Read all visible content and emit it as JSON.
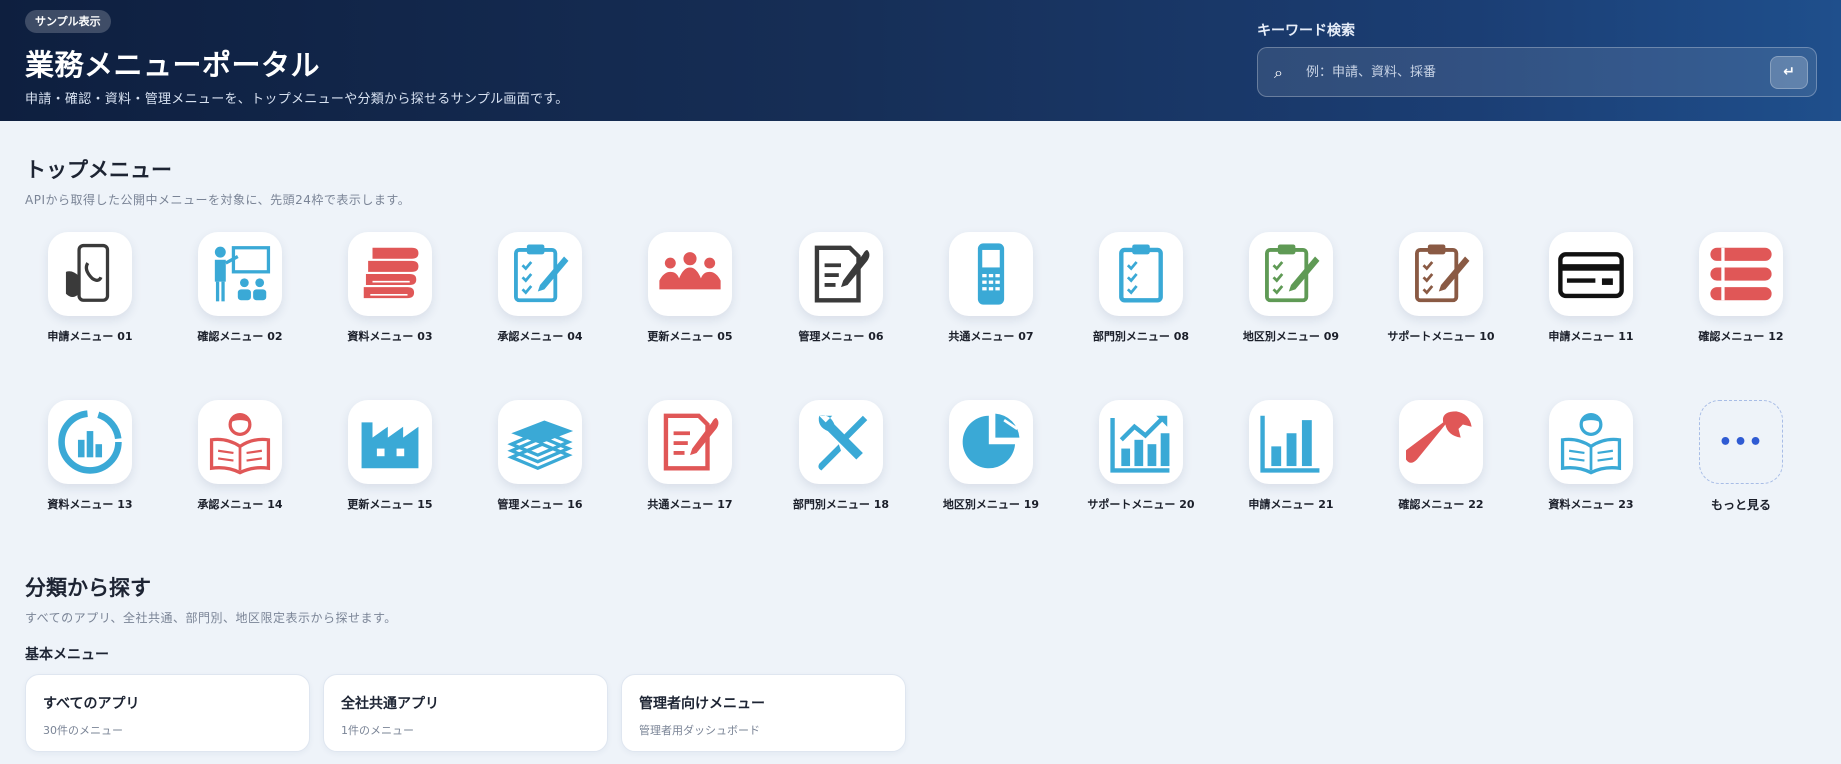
{
  "header": {
    "badge": "サンプル表示",
    "title": "業務メニューポータル",
    "subtitle": "申請・確認・資料・管理メニューを、トップメニューや分類から探せるサンプル画面です。",
    "search_label": "キーワード検索",
    "search_placeholder": "例：申請、資料、採番",
    "search_icon": "search-icon",
    "enter_icon": "enter-icon"
  },
  "top_menu": {
    "title": "トップメニュー",
    "description": "APIから取得した公開中メニューを対象に、先頭24枠で表示します。",
    "apps": [
      {
        "label": "申請メニュー 01",
        "icon": "phone-hand-icon",
        "color": "#3a3a3a"
      },
      {
        "label": "確認メニュー 02",
        "icon": "presentation-icon",
        "color": "#3aa9d6"
      },
      {
        "label": "資料メニュー 03",
        "icon": "books-icon",
        "color": "#e05757"
      },
      {
        "label": "承認メニュー 04",
        "icon": "clipboard-pen-icon",
        "color": "#3aa9d6"
      },
      {
        "label": "更新メニュー 05",
        "icon": "audience-icon",
        "color": "#e05757"
      },
      {
        "label": "管理メニュー 06",
        "icon": "document-pen-icon",
        "color": "#3a3a3a"
      },
      {
        "label": "共通メニュー 07",
        "icon": "mobile-phone-icon",
        "color": "#3aa9d6"
      },
      {
        "label": "部門別メニュー 08",
        "icon": "checklist-icon",
        "color": "#3aa9d6"
      },
      {
        "label": "地区別メニュー 09",
        "icon": "clipboard-pen-icon",
        "color": "#5f9a55"
      },
      {
        "label": "サポートメニュー 10",
        "icon": "clipboard-pen-icon",
        "color": "#8a5a44"
      },
      {
        "label": "申請メニュー 11",
        "icon": "id-card-icon",
        "color": "#111111"
      },
      {
        "label": "確認メニュー 12",
        "icon": "list-icon",
        "color": "#e05757"
      },
      {
        "label": "資料メニュー 13",
        "icon": "dashboard-chart-icon",
        "color": "#3aa9d6"
      },
      {
        "label": "承認メニュー 14",
        "icon": "reader-icon",
        "color": "#e05757"
      },
      {
        "label": "更新メニュー 15",
        "icon": "factory-icon",
        "color": "#3aa9d6"
      },
      {
        "label": "管理メニュー 16",
        "icon": "money-stack-icon",
        "color": "#3aa9d6"
      },
      {
        "label": "共通メニュー 17",
        "icon": "document-pen-icon",
        "color": "#e05757"
      },
      {
        "label": "部門別メニュー 18",
        "icon": "tools-icon",
        "color": "#3aa9d6"
      },
      {
        "label": "地区別メニュー 19",
        "icon": "pie-chart-icon",
        "color": "#3aa9d6"
      },
      {
        "label": "サポートメニュー 20",
        "icon": "growth-chart-icon",
        "color": "#3aa9d6"
      },
      {
        "label": "申請メニュー 21",
        "icon": "bar-chart-icon",
        "color": "#3aa9d6"
      },
      {
        "label": "確認メニュー 22",
        "icon": "wrench-icon",
        "color": "#e05757"
      },
      {
        "label": "資料メニュー 23",
        "icon": "reader-icon",
        "color": "#3aa9d6"
      }
    ],
    "more": {
      "label": "もっと見る",
      "dots": "•••"
    }
  },
  "categories": {
    "title": "分類から探す",
    "description": "すべてのアプリ、全社共通、部門別、地区限定表示から探せます。",
    "group_title": "基本メニュー",
    "cards": [
      {
        "name": "すべてのアプリ",
        "sub": "30件のメニュー"
      },
      {
        "name": "全社共通アプリ",
        "sub": "1件のメニュー"
      },
      {
        "name": "管理者向けメニュー",
        "sub": "管理者用ダッシュボード"
      }
    ]
  }
}
